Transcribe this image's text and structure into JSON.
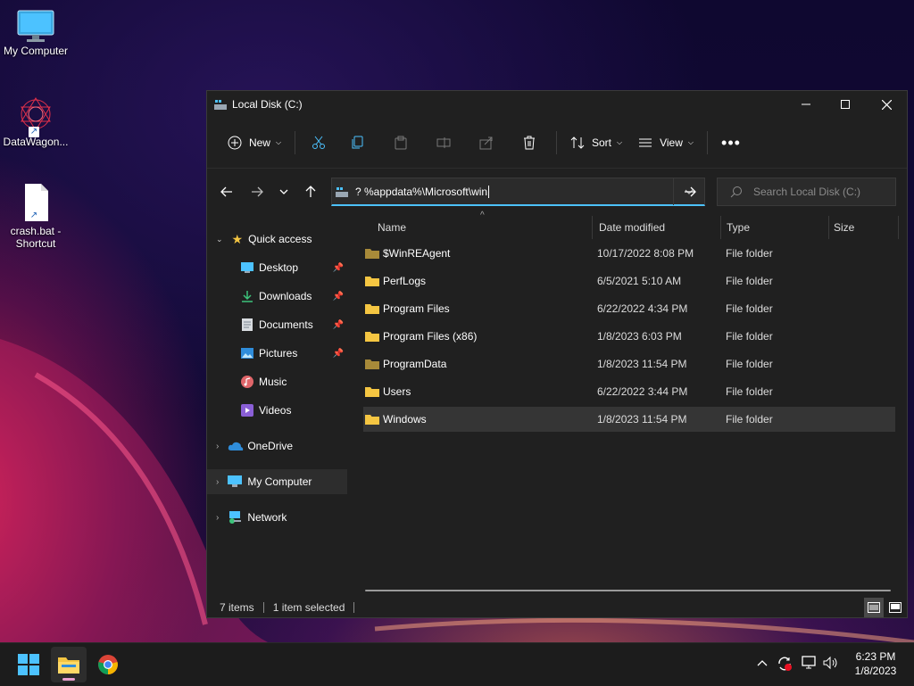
{
  "desktop": {
    "icons": [
      {
        "label": "My Computer"
      },
      {
        "label": "DataWagon..."
      },
      {
        "label_line1": "crash.bat -",
        "label_line2": "Shortcut"
      }
    ]
  },
  "window": {
    "title": "Local Disk (C:)",
    "toolbar": {
      "new_label": "New",
      "sort_label": "Sort",
      "view_label": "View"
    },
    "address": {
      "value": "? %appdata%\\Microsoft\\win"
    },
    "search": {
      "placeholder": "Search Local Disk (C:)"
    },
    "sidebar": {
      "quick_access": "Quick access",
      "items": [
        {
          "label": "Desktop",
          "pinned": true
        },
        {
          "label": "Downloads",
          "pinned": true
        },
        {
          "label": "Documents",
          "pinned": true
        },
        {
          "label": "Pictures",
          "pinned": true
        },
        {
          "label": "Music",
          "pinned": false
        },
        {
          "label": "Videos",
          "pinned": false
        }
      ],
      "onedrive": "OneDrive",
      "my_computer": "My Computer",
      "network": "Network"
    },
    "columns": {
      "name": "Name",
      "date": "Date modified",
      "type": "Type",
      "size": "Size"
    },
    "files": [
      {
        "name": "$WinREAgent",
        "date": "10/17/2022 8:08 PM",
        "type": "File folder",
        "hidden": true
      },
      {
        "name": "PerfLogs",
        "date": "6/5/2021 5:10 AM",
        "type": "File folder",
        "hidden": false
      },
      {
        "name": "Program Files",
        "date": "6/22/2022 4:34 PM",
        "type": "File folder",
        "hidden": false
      },
      {
        "name": "Program Files (x86)",
        "date": "1/8/2023 6:03 PM",
        "type": "File folder",
        "hidden": false
      },
      {
        "name": "ProgramData",
        "date": "1/8/2023 11:54 PM",
        "type": "File folder",
        "hidden": true
      },
      {
        "name": "Users",
        "date": "6/22/2022 3:44 PM",
        "type": "File folder",
        "hidden": false
      },
      {
        "name": "Windows",
        "date": "1/8/2023 11:54 PM",
        "type": "File folder",
        "hidden": false,
        "selected": true
      }
    ],
    "status": {
      "items": "7 items",
      "selected": "1 item selected"
    }
  },
  "taskbar": {
    "time": "6:23 PM",
    "date": "1/8/2023"
  },
  "colors": {
    "accent": "#4cc2ff",
    "folder": "#f4c542",
    "folder_hidden": "#a88a3a"
  }
}
